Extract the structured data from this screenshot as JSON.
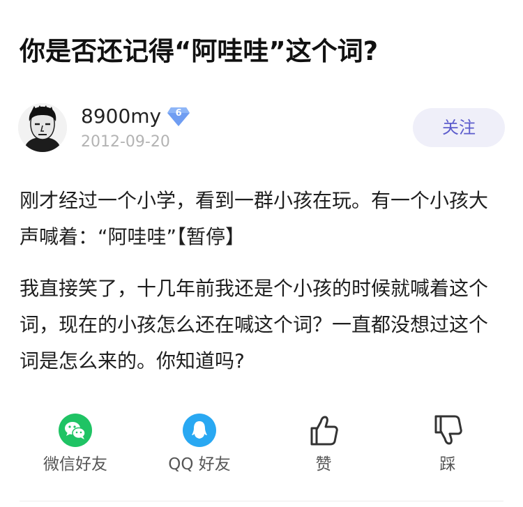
{
  "post": {
    "title": "你是否还记得“阿哇哇”这个词?",
    "author": {
      "name": "8900my",
      "level": "6",
      "date": "2012-09-20",
      "follow_label": "关注"
    },
    "paragraphs": [
      "刚才经过一个小学，看到一群小孩在玩。有一个小孩大声喊着：“阿哇哇”【暂停】",
      "我直接笑了，十几年前我还是个小孩的时候就喊着这个词，现在的小孩怎么还在喊这个词？一直都没想过这个词是怎么来的。你知道吗?"
    ]
  },
  "actions": {
    "wechat": {
      "label": "微信好友",
      "icon": "wechat-icon",
      "color": "#1fc364"
    },
    "qq": {
      "label": "QQ 好友",
      "icon": "qq-icon",
      "color": "#29a8f2"
    },
    "like": {
      "label": "赞",
      "icon": "thumbs-up-icon"
    },
    "dislike": {
      "label": "踩",
      "icon": "thumbs-down-icon"
    }
  },
  "colors": {
    "accent": "#5c5ccc",
    "follow_bg": "#efeff9",
    "badge": "#6f9df2",
    "muted_text": "#b3b3b3"
  }
}
